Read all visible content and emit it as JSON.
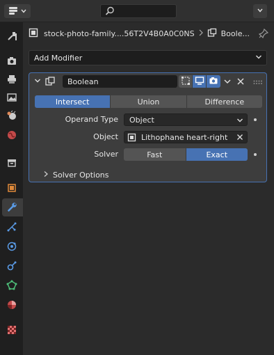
{
  "context": {
    "object_name": "stock-photo-family....56T2V4B0A0C0NS",
    "modifier_name": "Boole..."
  },
  "add_modifier": {
    "label": "Add Modifier"
  },
  "modifier": {
    "name": "Boolean",
    "operations": [
      {
        "label": "Intersect",
        "active": true
      },
      {
        "label": "Union",
        "active": false
      },
      {
        "label": "Difference",
        "active": false
      }
    ],
    "operand_type": {
      "label": "Operand Type",
      "value": "Object"
    },
    "object": {
      "label": "Object",
      "value": "Lithophane heart-right"
    },
    "solver": {
      "label": "Solver",
      "options": [
        {
          "label": "Fast",
          "active": false
        },
        {
          "label": "Exact",
          "active": true
        }
      ]
    },
    "solver_options": {
      "label": "Solver Options"
    }
  },
  "colors": {
    "accent": "#4772b3",
    "panel": "#3d3d3d",
    "background": "#2b2b2b"
  }
}
